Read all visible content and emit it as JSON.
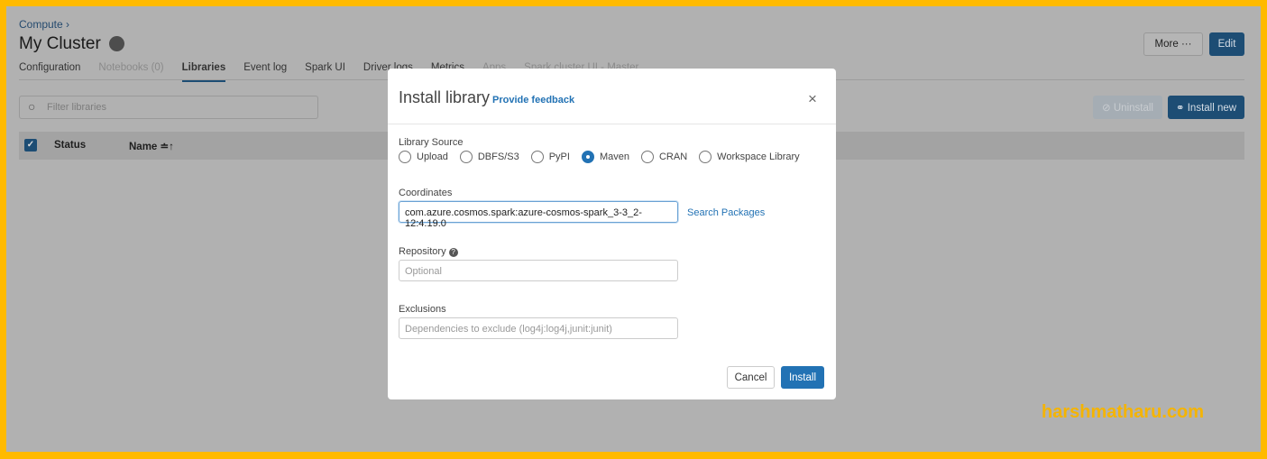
{
  "breadcrumb": "Compute ›",
  "title": "My Cluster",
  "tabs": [
    "Configuration",
    "Notebooks (0)",
    "Libraries",
    "Event log",
    "Spark UI",
    "Driver logs",
    "Metrics",
    "Apps",
    "Spark cluster UI - Master"
  ],
  "header_buttons": {
    "more": "More ···",
    "edit": "Edit"
  },
  "toolbar": {
    "filter_placeholder": "Filter libraries",
    "uninstall": "⊘ Uninstall",
    "install_new": "⚭ Install new"
  },
  "table": {
    "columns": [
      "Status",
      "Name ≐↑"
    ]
  },
  "modal": {
    "title": "Install library",
    "feedback": "Provide feedback",
    "close": "×",
    "source_label": "Library Source",
    "sources": [
      "Upload",
      "DBFS/S3",
      "PyPI",
      "Maven",
      "CRAN",
      "Workspace Library"
    ],
    "selected_source": "Maven",
    "coordinates_label": "Coordinates",
    "coordinates_value": "com.azure.cosmos.spark:azure-cosmos-spark_3-3_2-12:4.19.0",
    "search_packages": "Search Packages",
    "repository_label": "Repository",
    "repository_placeholder": "Optional",
    "exclusions_label": "Exclusions",
    "exclusions_placeholder": "Dependencies to exclude (log4j:log4j,junit:junit)",
    "cancel": "Cancel",
    "install": "Install"
  },
  "watermark": "harshmatharu.com",
  "colors": {
    "frame": "#ffba00",
    "primary": "#2272b4"
  }
}
